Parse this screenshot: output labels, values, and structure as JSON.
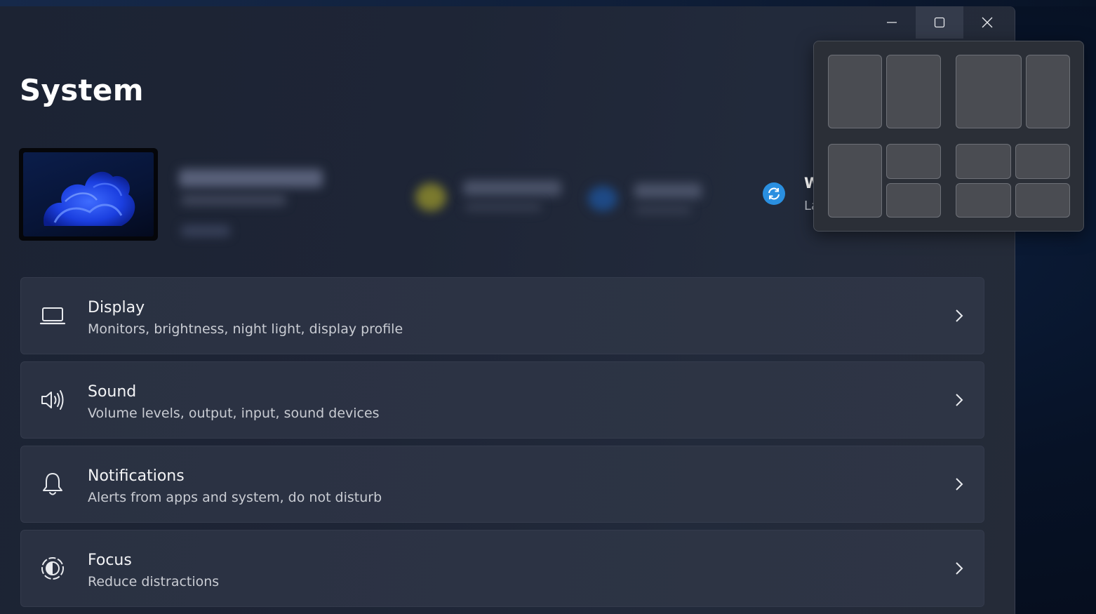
{
  "window": {
    "caption": {
      "minimize_icon": "minimize-icon",
      "maximize_icon": "maximize-icon",
      "close_icon": "close-icon"
    },
    "page_title": "System",
    "device": {
      "wallpaper_icon": "windows-bloom-wallpaper"
    },
    "update": {
      "icon": "sync-icon",
      "title": "W",
      "subtitle": "La"
    },
    "settings": [
      {
        "title": "Display",
        "subtitle": "Monitors, brightness, night light, display profile",
        "icon": "laptop-icon"
      },
      {
        "title": "Sound",
        "subtitle": "Volume levels, output, input, sound devices",
        "icon": "speaker-icon"
      },
      {
        "title": "Notifications",
        "subtitle": "Alerts from apps and system, do not disturb",
        "icon": "bell-icon"
      },
      {
        "title": "Focus",
        "subtitle": "Reduce distractions",
        "icon": "focus-icon"
      }
    ],
    "snap_layouts": {
      "layouts": [
        "two-equal-columns",
        "wide-left-narrow-right",
        "left-column-right-stacked",
        "four-quadrants"
      ]
    }
  },
  "colors": {
    "accent": "#2a8fe0",
    "window_bg": "#1e2536",
    "card_bg": "#2c3344",
    "snap_zone": "#4a4c52"
  }
}
